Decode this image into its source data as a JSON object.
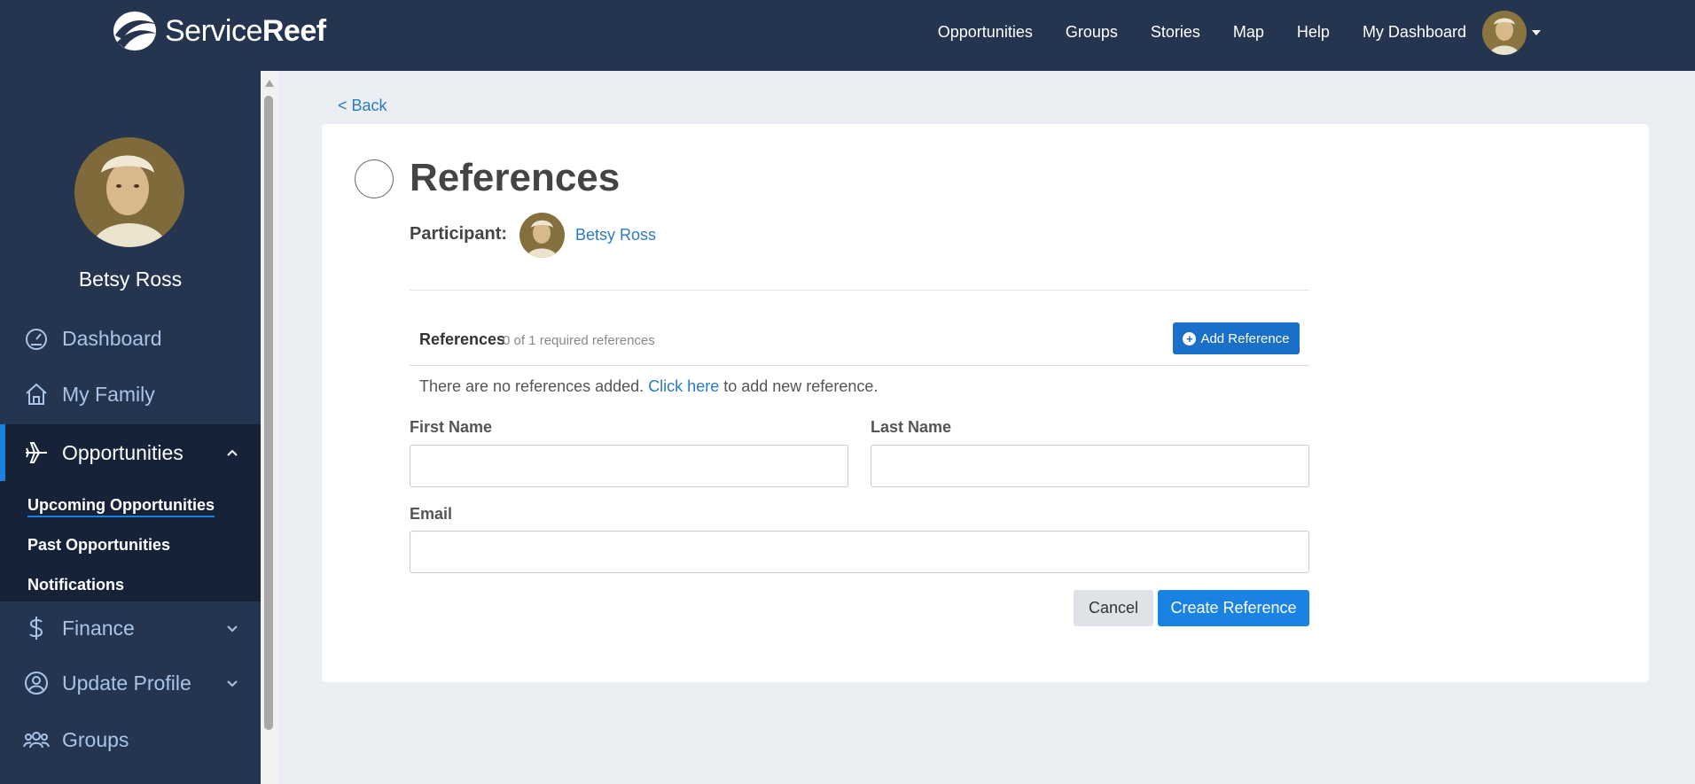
{
  "brand": {
    "name_light": "Service",
    "name_bold": "Reef"
  },
  "topnav": {
    "items": [
      "Opportunities",
      "Groups",
      "Stories",
      "Map",
      "Help",
      "My Dashboard"
    ]
  },
  "sidebar": {
    "user_name": "Betsy Ross",
    "items": [
      {
        "label": "Dashboard",
        "icon": "gauge-icon"
      },
      {
        "label": "My Family",
        "icon": "home-icon"
      },
      {
        "label": "Opportunities",
        "icon": "airplane-icon"
      },
      {
        "label": "Finance",
        "icon": "dollar-icon"
      },
      {
        "label": "Update Profile",
        "icon": "user-circle-icon"
      },
      {
        "label": "Groups",
        "icon": "users-icon"
      }
    ],
    "submenu": [
      "Upcoming Opportunities",
      "Past Opportunities",
      "Notifications"
    ]
  },
  "main": {
    "back_label": "< Back",
    "title": "References",
    "participant_label": "Participant:",
    "participant_name": "Betsy Ross",
    "references": {
      "heading": "References",
      "count_text": "0 of 1 required references",
      "add_button": "Add Reference",
      "empty_prefix": "There are no references added.",
      "empty_link": "Click here",
      "empty_suffix": "to add new reference."
    },
    "form": {
      "first_name_label": "First Name",
      "first_name_value": "",
      "last_name_label": "Last Name",
      "last_name_value": "",
      "email_label": "Email",
      "email_value": "",
      "cancel_label": "Cancel",
      "create_label": "Create Reference"
    }
  },
  "colors": {
    "nav_bg": "#253550",
    "accent": "#1a82e2",
    "link": "#2a7ac2",
    "page_bg": "#ebeef2"
  }
}
